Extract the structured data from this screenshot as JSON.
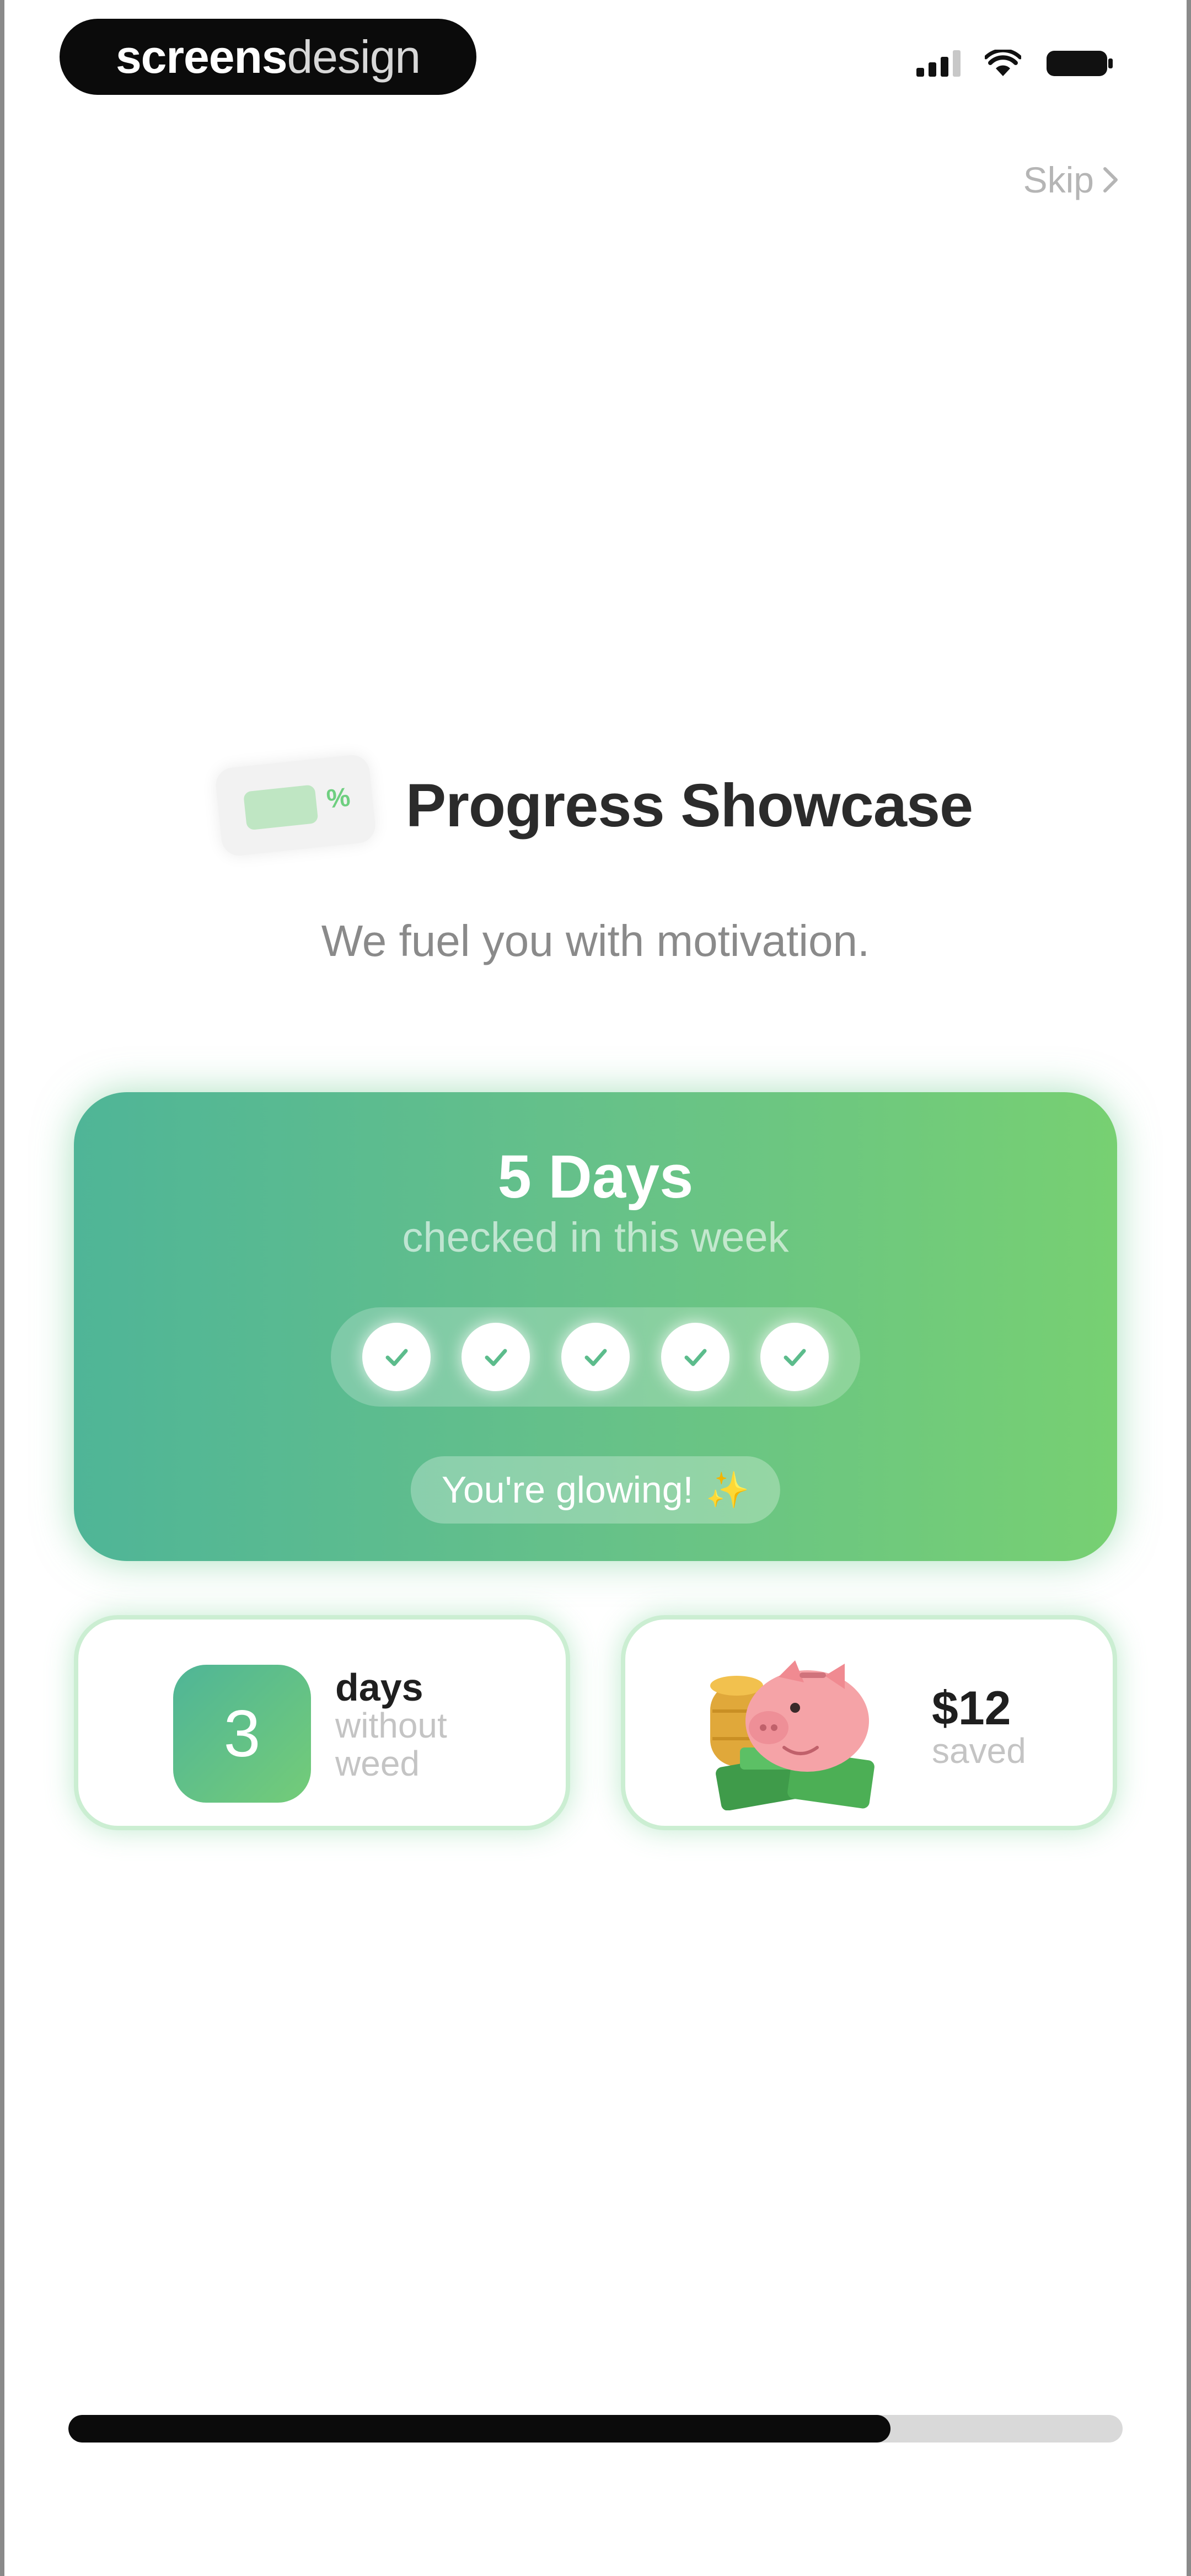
{
  "status_bar": {
    "brand_part1": "screens",
    "brand_part2": "design"
  },
  "header": {
    "skip_label": "Skip",
    "title": "Progress Showcase",
    "subtitle": "We fuel you with motivation.",
    "ticket_icon_symbol": "%"
  },
  "progress_card": {
    "days_label": "5 Days",
    "caption": "checked in this week",
    "checks": [
      {
        "done": true
      },
      {
        "done": true
      },
      {
        "done": true
      },
      {
        "done": true
      },
      {
        "done": true
      }
    ],
    "badge_text": "You're glowing!",
    "badge_icon": "sparkle-icon"
  },
  "stats": {
    "streak": {
      "number": "3",
      "label": "days",
      "sub1": "without",
      "sub2": "weed"
    },
    "savings": {
      "amount": "$12",
      "label": "saved",
      "icon": "piggy-bank-icon"
    }
  },
  "onboarding": {
    "progress_fraction": 0.78
  },
  "colors": {
    "card_gradient_start": "#4fb597",
    "card_gradient_end": "#77d072",
    "progress_fill": "#0b0b0b",
    "progress_track": "#d9d9d9"
  }
}
